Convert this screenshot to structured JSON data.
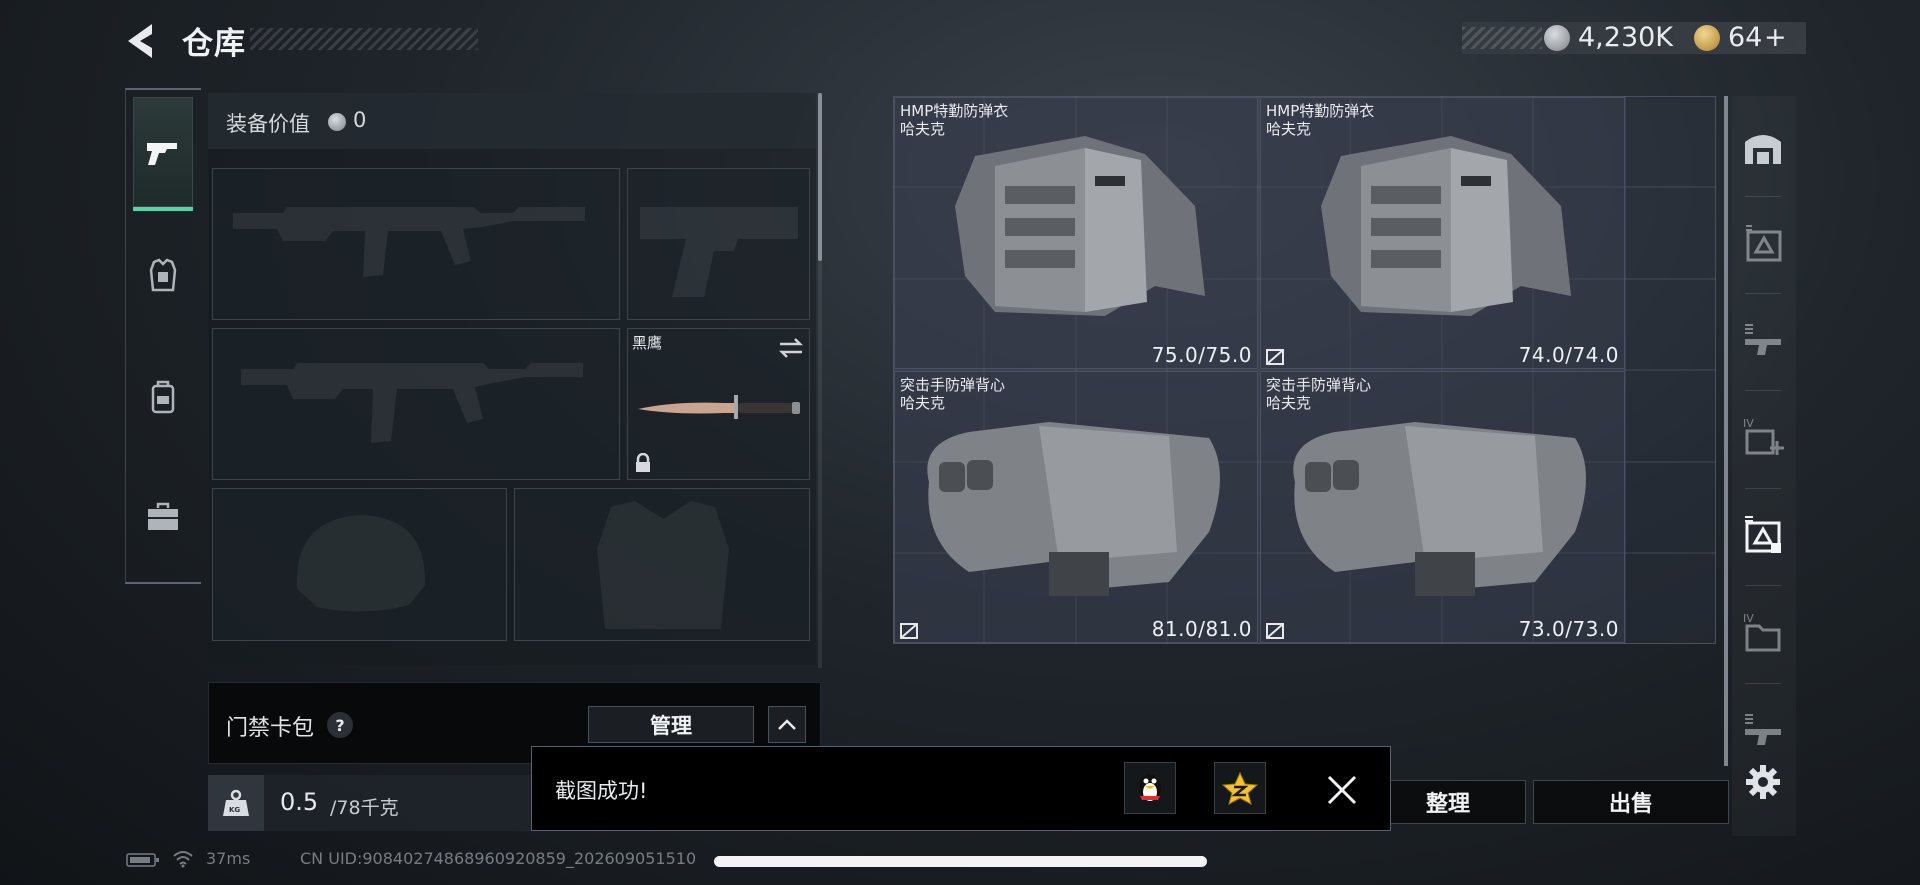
{
  "header": {
    "title": "仓库",
    "currency_coins": "4,230K",
    "currency_tokens": "64",
    "currency_tokens_plus": "+"
  },
  "left_rail": {
    "tabs": [
      {
        "name": "weapons",
        "icon": "pistol-icon",
        "active": true
      },
      {
        "name": "armor",
        "icon": "vest-icon",
        "active": false
      },
      {
        "name": "backpack",
        "icon": "backpack-icon",
        "active": false
      },
      {
        "name": "case",
        "icon": "toolbox-icon",
        "active": false
      }
    ],
    "accent_color": "#4fd7a5"
  },
  "equipment": {
    "value_label": "装备价值",
    "value_amount": "0",
    "melee_name": "黑鹰",
    "slots": [
      "primary-weapon",
      "pistol",
      "secondary-weapon",
      "melee",
      "helmet",
      "body-armor"
    ]
  },
  "card_pack": {
    "label": "门禁卡包",
    "help": "?",
    "manage_label": "管理"
  },
  "weight": {
    "current": "0.5",
    "max": "/78千克",
    "icon_label": "KG"
  },
  "stash": {
    "items": [
      {
        "name": "HMP特勤防弹衣",
        "brand": "哈夫克",
        "durability": "75.0/75.0",
        "marked": false
      },
      {
        "name": "HMP特勤防弹衣",
        "brand": "哈夫克",
        "durability": "74.0/74.0",
        "marked": true
      },
      {
        "name": "突击手防弹背心",
        "brand": "哈夫克",
        "durability": "81.0/81.0",
        "marked": true
      },
      {
        "name": "突击手防弹背心",
        "brand": "哈夫克",
        "durability": "73.0/73.0",
        "marked": true
      }
    ]
  },
  "actions": {
    "sort_label": "整理",
    "sell_label": "出售"
  },
  "toast": {
    "message": "截图成功!"
  },
  "status_bar": {
    "ping": "37ms",
    "uid": "CN UID:9084027486896092085​9_202609051510"
  }
}
